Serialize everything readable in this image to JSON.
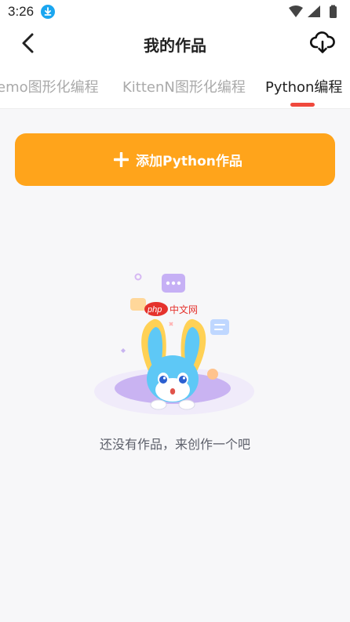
{
  "status_bar": {
    "time": "3:26",
    "icons": [
      "download-icon",
      "wifi-icon",
      "signal-icon",
      "battery-icon"
    ]
  },
  "header": {
    "title": "我的作品",
    "icons": [
      "back-arrow-icon",
      "cloud-download-icon"
    ]
  },
  "tabs": [
    {
      "label": "emo图形化编程",
      "active": false
    },
    {
      "label": "KittenN图形化编程",
      "active": false
    },
    {
      "label": "Python编程",
      "active": true
    }
  ],
  "add_button": {
    "label": "添加Python作品",
    "icon": "plus-icon"
  },
  "empty_state": {
    "text": "还没有作品，来创作一个吧",
    "watermark": "php中文网"
  },
  "colors": {
    "accent": "#ffa41b",
    "tab_indicator": "#f0483c",
    "background": "#f7f7f9"
  }
}
